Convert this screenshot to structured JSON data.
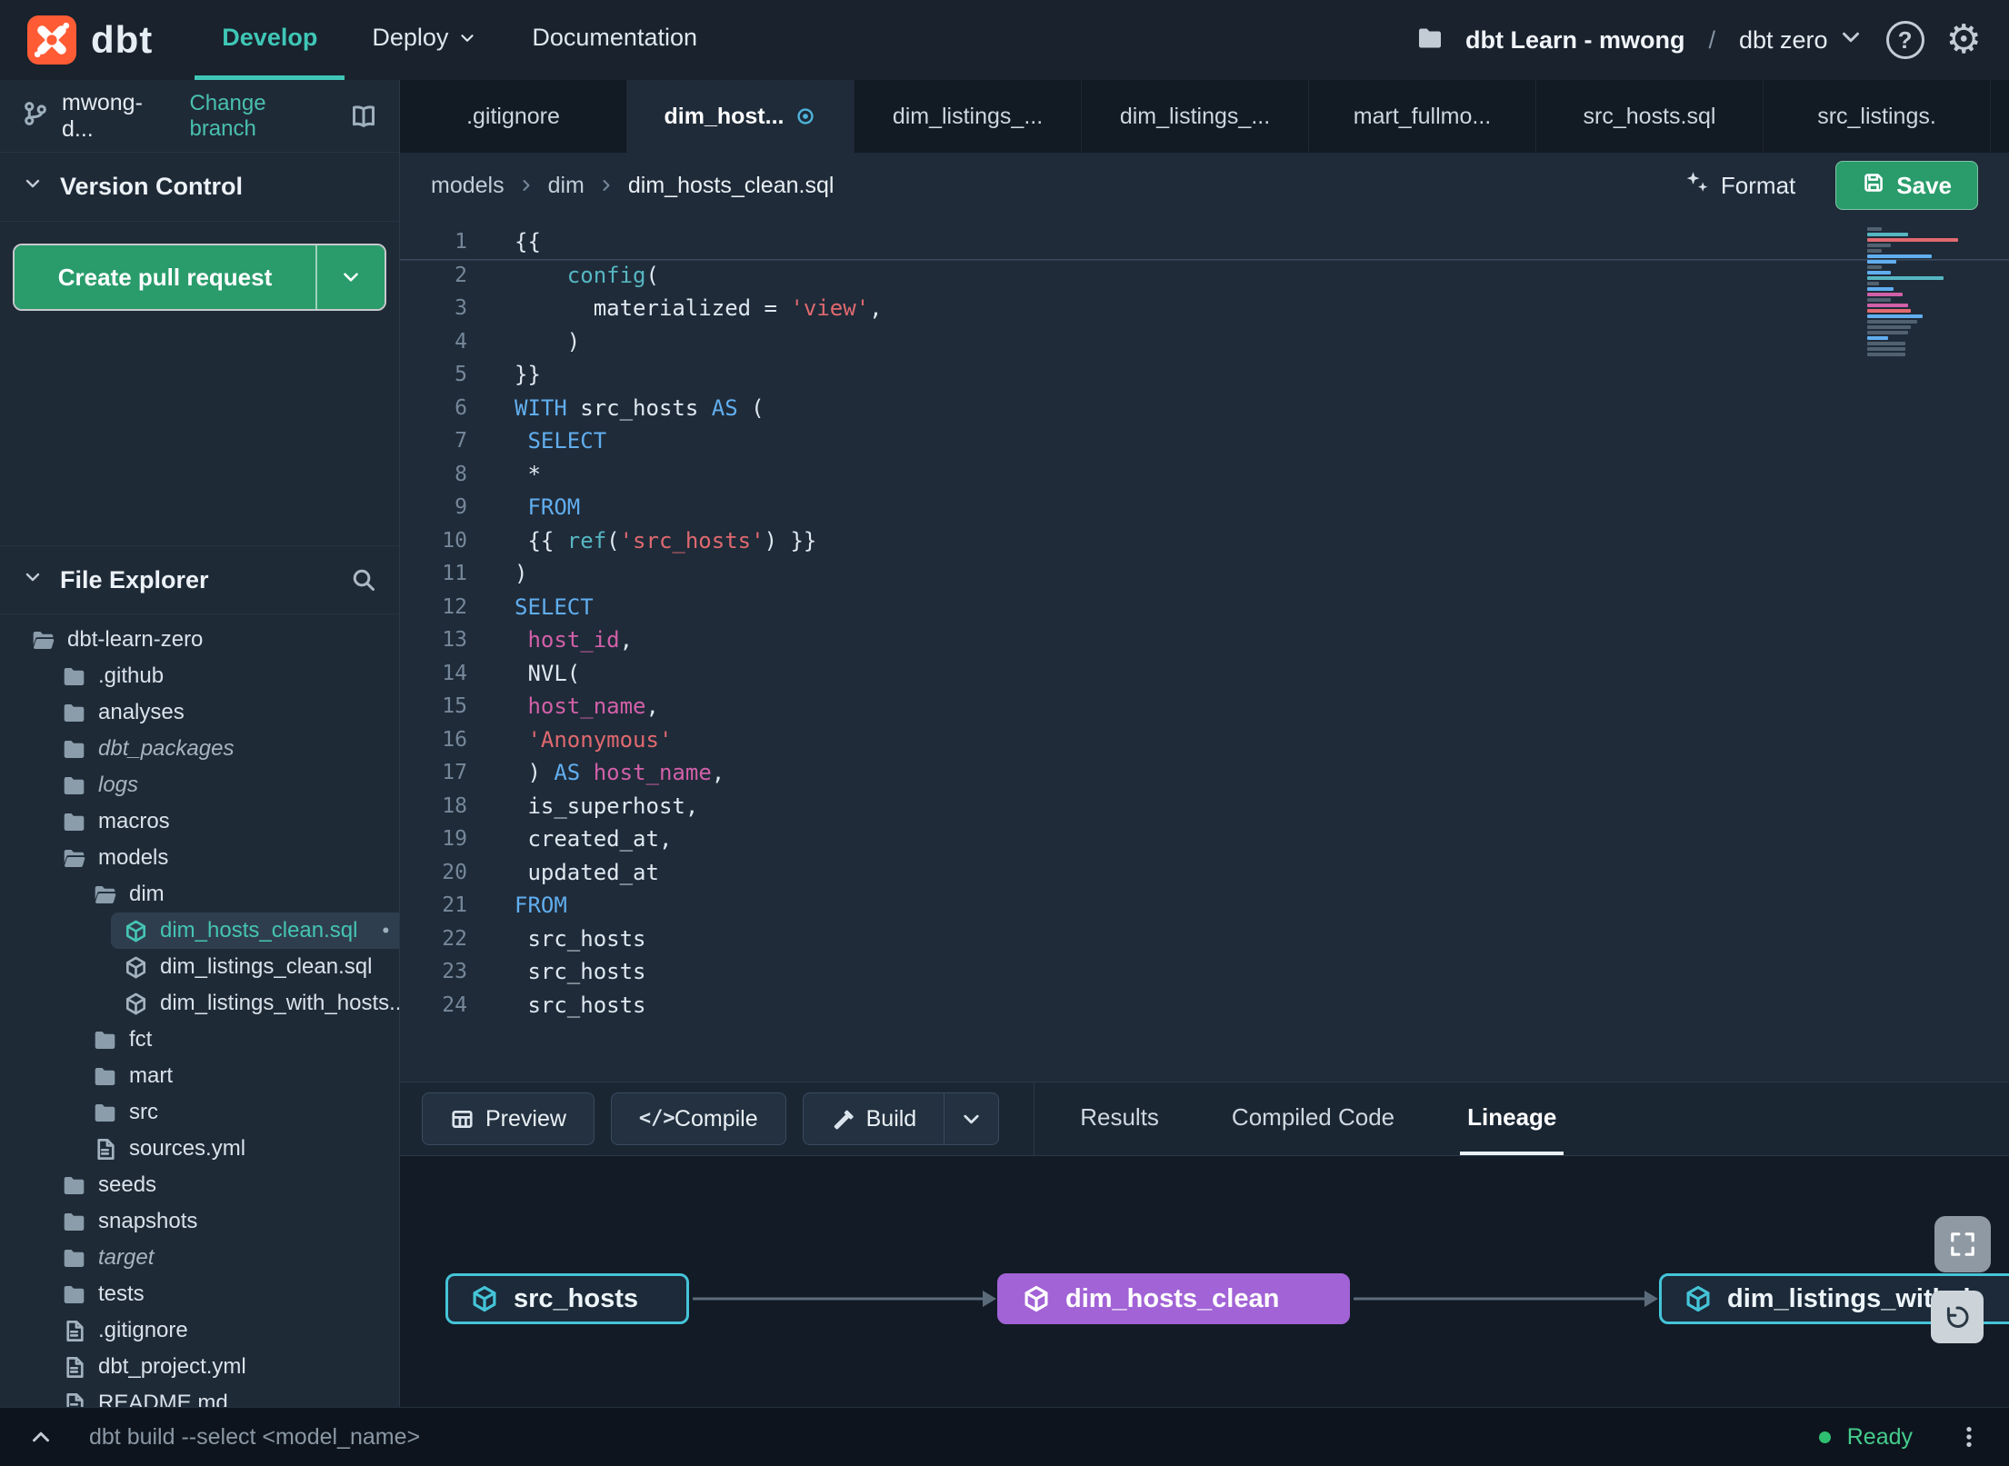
{
  "nav": {
    "brand": "dbt",
    "items": [
      {
        "label": "Develop",
        "active": true,
        "chevron": false
      },
      {
        "label": "Deploy",
        "active": false,
        "chevron": true
      },
      {
        "label": "Documentation",
        "active": false,
        "chevron": false
      }
    ],
    "project": "dbt Learn - mwong",
    "separator": "/",
    "environment": "dbt zero"
  },
  "sidebar": {
    "branch_name": "mwong-d...",
    "change_branch_label": "Change branch",
    "version_control_label": "Version Control",
    "create_pr_label": "Create pull request",
    "file_explorer_label": "File Explorer",
    "tree": [
      {
        "label": "dbt-learn-zero",
        "icon": "folder-open",
        "level": 0
      },
      {
        "label": ".github",
        "icon": "folder",
        "level": 1
      },
      {
        "label": "analyses",
        "icon": "folder",
        "level": 1
      },
      {
        "label": "dbt_packages",
        "icon": "folder",
        "level": 1,
        "italic": true
      },
      {
        "label": "logs",
        "icon": "folder",
        "level": 1,
        "italic": true
      },
      {
        "label": "macros",
        "icon": "folder",
        "level": 1
      },
      {
        "label": "models",
        "icon": "folder-open",
        "level": 1
      },
      {
        "label": "dim",
        "icon": "folder-open",
        "level": 2
      },
      {
        "label": "dim_hosts_clean.sql",
        "icon": "cube",
        "level": 3,
        "selected": true,
        "modified": true
      },
      {
        "label": "dim_listings_clean.sql",
        "icon": "cube",
        "level": 3
      },
      {
        "label": "dim_listings_with_hosts...",
        "icon": "cube",
        "level": 3
      },
      {
        "label": "fct",
        "icon": "folder",
        "level": 2
      },
      {
        "label": "mart",
        "icon": "folder",
        "level": 2
      },
      {
        "label": "src",
        "icon": "folder",
        "level": 2
      },
      {
        "label": "sources.yml",
        "icon": "file",
        "level": 2
      },
      {
        "label": "seeds",
        "icon": "folder",
        "level": 1
      },
      {
        "label": "snapshots",
        "icon": "folder",
        "level": 1
      },
      {
        "label": "target",
        "icon": "folder",
        "level": 1,
        "italic": true
      },
      {
        "label": "tests",
        "icon": "folder",
        "level": 1
      },
      {
        "label": ".gitignore",
        "icon": "file",
        "level": 1
      },
      {
        "label": "dbt_project.yml",
        "icon": "file",
        "level": 1
      },
      {
        "label": "README.md",
        "icon": "file",
        "level": 1
      }
    ]
  },
  "tabs": [
    {
      "label": ".gitignore"
    },
    {
      "label": "dim_host...",
      "active": true,
      "modified": true
    },
    {
      "label": "dim_listings_..."
    },
    {
      "label": "dim_listings_..."
    },
    {
      "label": "mart_fullmo..."
    },
    {
      "label": "src_hosts.sql"
    },
    {
      "label": "src_listings."
    }
  ],
  "breadcrumb": [
    "models",
    "dim",
    "dim_hosts_clean.sql"
  ],
  "editor_actions": {
    "format_label": "Format",
    "save_label": "Save"
  },
  "editor": {
    "lines": [
      {
        "n": 1,
        "active": true,
        "tokens": [
          [
            "{{",
            "p"
          ]
        ]
      },
      {
        "n": 2,
        "tokens": [
          [
            "    ",
            "p"
          ],
          [
            "config",
            "f"
          ],
          [
            "(",
            "p"
          ]
        ]
      },
      {
        "n": 3,
        "tokens": [
          [
            "      ",
            "p"
          ],
          [
            "materialized = ",
            "p"
          ],
          [
            "'view'",
            "s"
          ],
          [
            ",",
            "p"
          ]
        ]
      },
      {
        "n": 4,
        "tokens": [
          [
            "    )",
            "p"
          ]
        ]
      },
      {
        "n": 5,
        "tokens": [
          [
            "}}",
            "p"
          ]
        ]
      },
      {
        "n": 6,
        "tokens": [
          [
            "WITH",
            "k"
          ],
          [
            " src_hosts ",
            "p"
          ],
          [
            "AS",
            "k"
          ],
          [
            " (",
            "p"
          ]
        ]
      },
      {
        "n": 7,
        "tokens": [
          [
            " ",
            "p"
          ],
          [
            "SELECT",
            "k"
          ]
        ]
      },
      {
        "n": 8,
        "tokens": [
          [
            " *",
            "p"
          ]
        ]
      },
      {
        "n": 9,
        "tokens": [
          [
            " ",
            "p"
          ],
          [
            "FROM",
            "k"
          ]
        ]
      },
      {
        "n": 10,
        "tokens": [
          [
            " {{ ",
            "p"
          ],
          [
            "ref",
            "f"
          ],
          [
            "(",
            "p"
          ],
          [
            "'src_hosts'",
            "s"
          ],
          [
            ") }}",
            "p"
          ]
        ]
      },
      {
        "n": 11,
        "tokens": [
          [
            ")",
            "p"
          ]
        ]
      },
      {
        "n": 12,
        "tokens": [
          [
            "SELECT",
            "k"
          ]
        ]
      },
      {
        "n": 13,
        "tokens": [
          [
            " ",
            "p"
          ],
          [
            "host_id",
            "v"
          ],
          [
            ",",
            "p"
          ]
        ]
      },
      {
        "n": 14,
        "tokens": [
          [
            " NVL(",
            "p"
          ]
        ]
      },
      {
        "n": 15,
        "tokens": [
          [
            " ",
            "p"
          ],
          [
            "host_name",
            "v"
          ],
          [
            ",",
            "p"
          ]
        ]
      },
      {
        "n": 16,
        "tokens": [
          [
            " ",
            "p"
          ],
          [
            "'Anonymous'",
            "s"
          ]
        ]
      },
      {
        "n": 17,
        "tokens": [
          [
            " ) ",
            "p"
          ],
          [
            "AS",
            "k"
          ],
          [
            " ",
            "p"
          ],
          [
            "host_name",
            "v"
          ],
          [
            ",",
            "p"
          ]
        ]
      },
      {
        "n": 18,
        "tokens": [
          [
            " is_superhost,",
            "p"
          ]
        ]
      },
      {
        "n": 19,
        "tokens": [
          [
            " created_at,",
            "p"
          ]
        ]
      },
      {
        "n": 20,
        "tokens": [
          [
            " updated_at",
            "p"
          ]
        ]
      },
      {
        "n": 21,
        "tokens": [
          [
            "FROM",
            "k"
          ]
        ]
      },
      {
        "n": 22,
        "tokens": [
          [
            " src_hosts",
            "p"
          ]
        ]
      },
      {
        "n": 23,
        "tokens": [
          [
            " src_hosts",
            "p"
          ]
        ]
      },
      {
        "n": 24,
        "tokens": [
          [
            " src_hosts",
            "p"
          ]
        ]
      }
    ]
  },
  "panel": {
    "buttons": [
      {
        "label": "Preview",
        "icon": "table"
      },
      {
        "label": "Compile",
        "icon": "code"
      },
      {
        "label": "Build",
        "icon": "hammer",
        "split": true
      }
    ],
    "tabs": [
      {
        "label": "Results"
      },
      {
        "label": "Compiled Code"
      },
      {
        "label": "Lineage",
        "active": true
      }
    ]
  },
  "lineage": {
    "nodes": [
      {
        "label": "src_hosts",
        "variant": "teal"
      },
      {
        "label": "dim_hosts_clean",
        "variant": "purple"
      },
      {
        "label": "dim_listings_with_h",
        "variant": "teal"
      }
    ]
  },
  "statusbar": {
    "command": "dbt build --select <model_name>",
    "status": "Ready"
  },
  "colors": {
    "accent_teal": "#3fc6b6",
    "button_green": "#2a9c6c",
    "node_purple": "#a263d6",
    "brand_orange": "#ff5c35"
  }
}
